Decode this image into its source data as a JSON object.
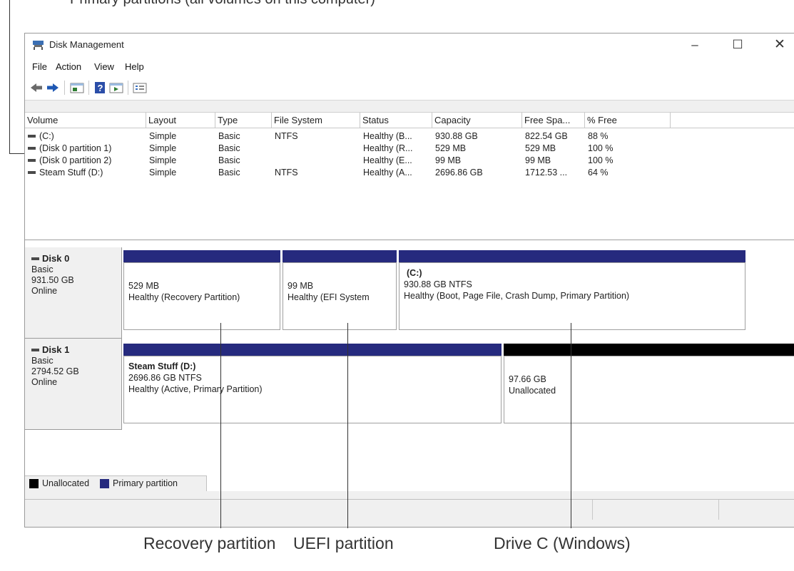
{
  "window": {
    "title": "Disk Management"
  },
  "menu": [
    "File",
    "Action",
    "View",
    "Help"
  ],
  "volume_table": {
    "columns": [
      "Volume",
      "Layout",
      "Type",
      "File System",
      "Status",
      "Capacity",
      "Free Spa...",
      "% Free"
    ],
    "rows": [
      [
        "(C:)",
        "Simple",
        "Basic",
        "NTFS",
        "Healthy (B...",
        "930.88 GB",
        "822.54 GB",
        "88 %"
      ],
      [
        "(Disk 0 partition 1)",
        "Simple",
        "Basic",
        "",
        "Healthy (R...",
        "529 MB",
        "529 MB",
        "100 %"
      ],
      [
        "(Disk 0 partition 2)",
        "Simple",
        "Basic",
        "",
        "Healthy (E...",
        "99 MB",
        "99 MB",
        "100 %"
      ],
      [
        "Steam Stuff (D:)",
        "Simple",
        "Basic",
        "NTFS",
        "Healthy (A...",
        "2696.86 GB",
        "1712.53 ...",
        "64 %"
      ]
    ]
  },
  "disks": [
    {
      "name": "Disk 0",
      "type": "Basic",
      "size": "931.50 GB",
      "state": "Online",
      "partitions": [
        {
          "label": "",
          "line1": "529 MB",
          "line2": "Healthy (Recovery Partition)",
          "kind": "primary"
        },
        {
          "label": "",
          "line1": "99 MB",
          "line2": "Healthy (EFI System",
          "kind": "primary"
        },
        {
          "label": "(C:)",
          "line1": "930.88 GB NTFS",
          "line2": "Healthy (Boot, Page File, Crash Dump, Primary Partition)",
          "kind": "primary"
        }
      ]
    },
    {
      "name": "Disk 1",
      "type": "Basic",
      "size": "2794.52 GB",
      "state": "Online",
      "partitions": [
        {
          "label": "Steam Stuff  (D:)",
          "line1": "2696.86 GB NTFS",
          "line2": "Healthy (Active, Primary Partition)",
          "kind": "primary"
        },
        {
          "label": "",
          "line1": "97.66 GB",
          "line2": "Unallocated",
          "kind": "unallocated"
        }
      ]
    }
  ],
  "legend": [
    {
      "label": "Unallocated",
      "color": "#000000"
    },
    {
      "label": "Primary partition",
      "color": "#262a7e"
    }
  ],
  "callouts": {
    "top": "Primary partitions (all volumes on this computer)",
    "bottom": [
      "Recovery partition",
      "UEFI partition",
      "Drive C (Windows)"
    ]
  }
}
